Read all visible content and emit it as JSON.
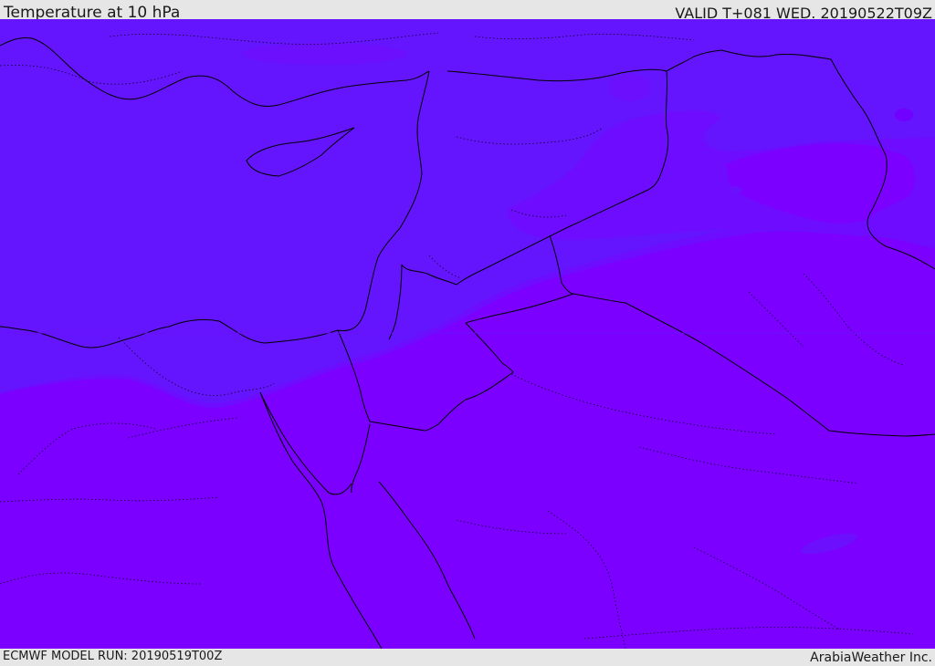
{
  "header": {
    "title": "Temperature at 10 hPa",
    "valid_time": "VALID T+081 WED. 20190522T09Z"
  },
  "footer": {
    "model_run": "ECMWF MODEL RUN: 20190519T00Z",
    "credit": "ArabiaWeather Inc."
  },
  "map": {
    "colors": {
      "cold_zone": "#6415fd",
      "mid_zone": "#6e0cff",
      "warm_zone": "#7b00ff",
      "coastline": "#000000",
      "borders": "#000000"
    }
  }
}
